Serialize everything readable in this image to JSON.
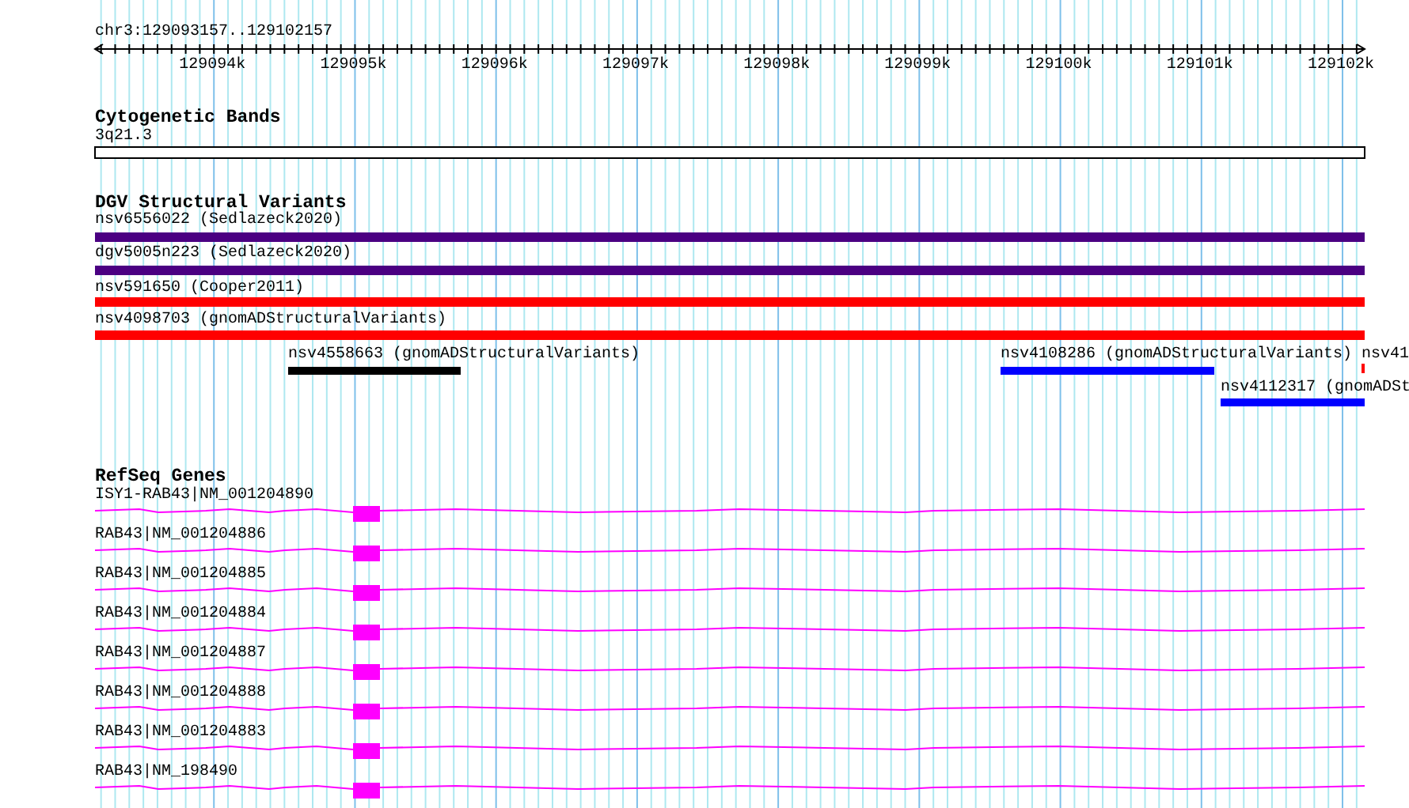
{
  "ruler": {
    "location": "chr3:129093157..129102157",
    "ticks": [
      "129094k",
      "129095k",
      "129096k",
      "129097k",
      "129098k",
      "129099k",
      "129100k",
      "129101k",
      "129102k"
    ]
  },
  "tracks": [
    {
      "kind": "cytoband",
      "title": "Cytogenetic Bands",
      "features": [
        {
          "label": "3q21.3"
        }
      ]
    },
    {
      "kind": "variants",
      "title": "DGV Structural Variants",
      "features": [
        {
          "label": "nsv6556022 (Sedlazeck2020)",
          "color": "#4b0082"
        },
        {
          "label": "dgv5005n223 (Sedlazeck2020)",
          "color": "#4b0082"
        },
        {
          "label": "nsv591650 (Cooper2011)",
          "color": "#ff0000"
        },
        {
          "label": "nsv4098703 (gnomADStructuralVariants)",
          "color": "#ff0000"
        },
        {
          "label": "nsv4558663 (gnomADStructuralVariants)",
          "color": "#000000"
        },
        {
          "label": "nsv4108286 (gnomADStructuralVariants)",
          "color": "#0000ff"
        },
        {
          "label": "nsv41",
          "color": "#ff0000"
        },
        {
          "label": "nsv4112317 (gnomADSt",
          "color": "#0000ff"
        }
      ]
    },
    {
      "kind": "genes",
      "title": "RefSeq Genes",
      "features": [
        {
          "label": "ISY1-RAB43|NM_001204890"
        },
        {
          "label": "RAB43|NM_001204886"
        },
        {
          "label": "RAB43|NM_001204885"
        },
        {
          "label": "RAB43|NM_001204884"
        },
        {
          "label": "RAB43|NM_001204887"
        },
        {
          "label": "RAB43|NM_001204888"
        },
        {
          "label": "RAB43|NM_001204883"
        },
        {
          "label": "RAB43|NM_198490"
        }
      ]
    }
  ]
}
